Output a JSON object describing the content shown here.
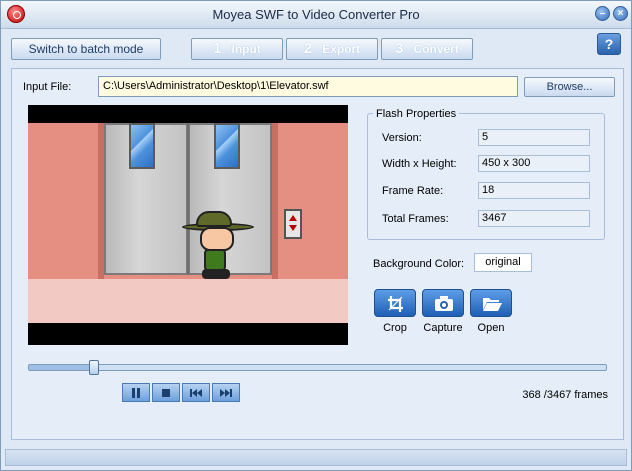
{
  "window": {
    "title": "Moyea SWF to Video Converter Pro"
  },
  "toolbar": {
    "batch_label": "Switch to batch mode",
    "steps": [
      {
        "num": "1",
        "label": "Input"
      },
      {
        "num": "2",
        "label": "Export"
      },
      {
        "num": "3",
        "label": "Convert"
      }
    ],
    "help_label": "?"
  },
  "input": {
    "label": "Input File:",
    "value": "C:\\Users\\Administrator\\Desktop\\1\\Elevator.swf",
    "browse_label": "Browse..."
  },
  "flash_properties": {
    "title": "Flash Properties",
    "rows": [
      {
        "label": "Version:",
        "value": "5"
      },
      {
        "label": "Width x Height:",
        "value": "450 x 300"
      },
      {
        "label": "Frame Rate:",
        "value": "18"
      },
      {
        "label": "Total Frames:",
        "value": "3467"
      }
    ]
  },
  "background": {
    "label": "Background Color:",
    "value": "original"
  },
  "tools": [
    {
      "label": "Crop",
      "icon": "crop-icon"
    },
    {
      "label": "Capture",
      "icon": "camera-icon"
    },
    {
      "label": "Open",
      "icon": "folder-open-icon"
    }
  ],
  "playback": {
    "current_frame": 368,
    "total_frames": 3467,
    "progress": 0.1061,
    "frames_text": "368 /3467 frames",
    "buttons": [
      "pause-icon",
      "stop-icon",
      "rewind-icon",
      "fast-forward-icon"
    ]
  },
  "colors": {
    "accent": "#2a62ad",
    "input_bg": "#fffbe0",
    "panel_bg": "#e4edf8"
  }
}
